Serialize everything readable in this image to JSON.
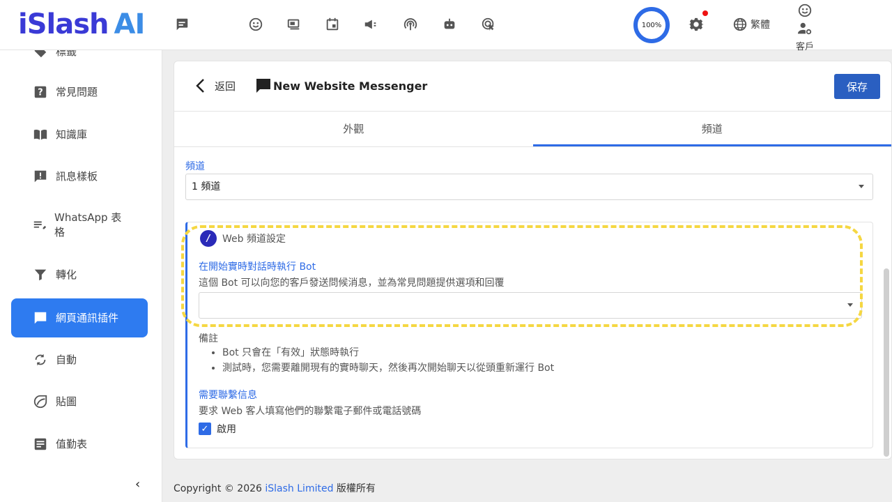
{
  "header": {
    "logo_main": "iSlash",
    "logo_ai": "AI",
    "progress": "100%",
    "language": "繁體",
    "user_label": "客戶"
  },
  "sidebar": {
    "items": [
      {
        "label": "標籤"
      },
      {
        "label": "常見問題"
      },
      {
        "label": "知識庫"
      },
      {
        "label": "訊息樣板"
      },
      {
        "label": "WhatsApp 表格"
      },
      {
        "label": "轉化"
      },
      {
        "label": "網頁通訊插件"
      },
      {
        "label": "自動"
      },
      {
        "label": "貼圖"
      },
      {
        "label": "值勤表"
      }
    ],
    "collapse_glyph": "‹"
  },
  "page": {
    "back_label": "返回",
    "title": "New Website Messenger",
    "save_label": "保存",
    "tabs": [
      {
        "label": "外觀"
      },
      {
        "label": "頻道"
      }
    ],
    "channel_label": "頻道",
    "channel_value": "1 頻道",
    "panel": {
      "title": "Web 頻道設定",
      "bot_label": "在開始實時對話時執行 Bot",
      "bot_desc": "這個 Bot 可以向您的客戶發送問候消息，並為常見問題提供選項和回覆",
      "bot_value": "",
      "note_title": "備註",
      "notes": [
        "Bot 只會在「有效」狀態時執行",
        "測試時，您需要離開現有的實時聊天，然後再次開始聊天以從頭重新運行 Bot"
      ],
      "contact_label": "需要聯繫信息",
      "contact_desc": "要求 Web 客人填寫他們的聯繫電子郵件或電話號碼",
      "enable_label": "啟用"
    }
  },
  "footer": {
    "prefix": "Copyright © 2026 ",
    "brand": "iSlash Limited",
    "suffix": " 版權所有"
  },
  "colors": {
    "accent": "#2e6be6",
    "active_sidebar": "#2e7bf0",
    "save_button": "#2a5fc1",
    "highlight": "#f5d742",
    "logo": "#3a3ad6"
  }
}
